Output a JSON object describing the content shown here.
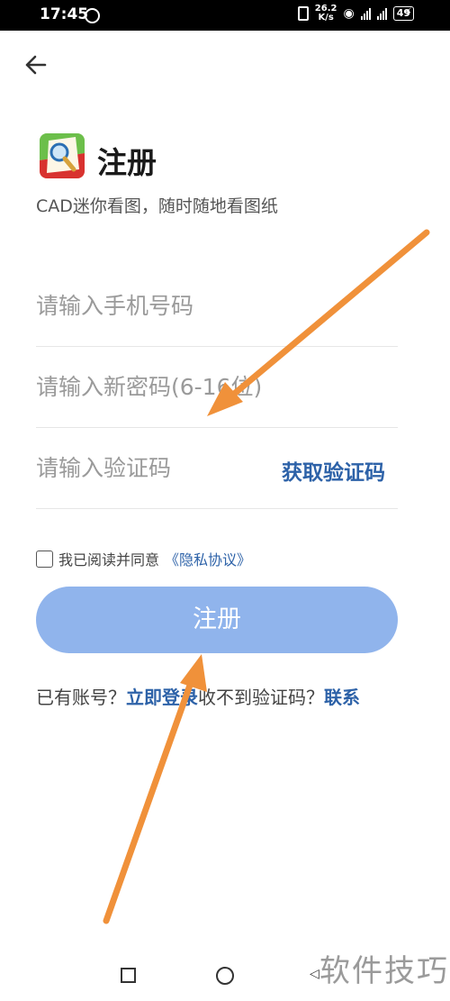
{
  "status_bar": {
    "time": "17:45",
    "net_speed_value": "26.2",
    "net_speed_unit": "K/s",
    "battery": "49"
  },
  "header": {
    "back_icon": "arrow-left-icon",
    "app_logo": "cad-viewer-logo",
    "title": "注册",
    "subtitle": "CAD迷你看图，随时随地看图纸"
  },
  "form": {
    "phone_placeholder": "请输入手机号码",
    "password_placeholder": "请输入新密码(6-16位)",
    "code_placeholder": "请输入验证码",
    "get_code_label": "获取验证码",
    "agree_text": "我已阅读并同意",
    "agree_link": "《隐私协议》",
    "agree_checked": false,
    "register_label": "注册"
  },
  "footer": {
    "has_account": "已有账号？",
    "login_link": "立即登录",
    "no_code": "收不到验证码？",
    "contact_link": "联系"
  },
  "watermark": "软件技巧",
  "colors": {
    "accent": "#2d62a8",
    "button": "#90b4ec",
    "annotation_arrow": "#f0913a"
  }
}
